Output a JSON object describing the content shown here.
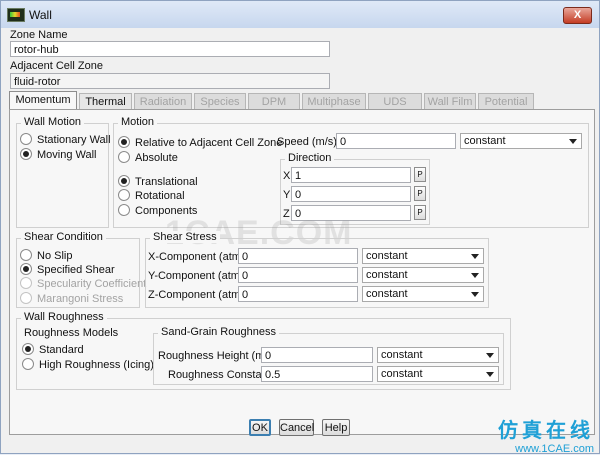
{
  "window": {
    "title": "Wall",
    "close_label": "X"
  },
  "zone_name": {
    "label": "Zone Name",
    "value": "rotor-hub"
  },
  "adjacent_cell_zone": {
    "label": "Adjacent Cell Zone",
    "value": "fluid-rotor"
  },
  "tabs": [
    {
      "label": "Momentum",
      "state": "active"
    },
    {
      "label": "Thermal",
      "state": "enabled"
    },
    {
      "label": "Radiation",
      "state": "disabled"
    },
    {
      "label": "Species",
      "state": "disabled"
    },
    {
      "label": "DPM",
      "state": "disabled"
    },
    {
      "label": "Multiphase",
      "state": "disabled"
    },
    {
      "label": "UDS",
      "state": "disabled"
    },
    {
      "label": "Wall Film",
      "state": "disabled"
    },
    {
      "label": "Potential",
      "state": "disabled"
    }
  ],
  "wall_motion": {
    "title": "Wall Motion",
    "options": [
      {
        "label": "Stationary Wall",
        "selected": false
      },
      {
        "label": "Moving Wall",
        "selected": true
      }
    ]
  },
  "motion": {
    "title": "Motion",
    "frame_options": [
      {
        "label": "Relative to Adjacent Cell Zone",
        "selected": true
      },
      {
        "label": "Absolute",
        "selected": false
      }
    ],
    "type_options": [
      {
        "label": "Translational",
        "selected": true
      },
      {
        "label": "Rotational",
        "selected": false
      },
      {
        "label": "Components",
        "selected": false
      }
    ],
    "speed_label": "Speed (m/s)",
    "speed_value": "0",
    "speed_method": "constant",
    "direction": {
      "title": "Direction",
      "x_label": "X",
      "x_value": "1",
      "y_label": "Y",
      "y_value": "0",
      "z_label": "Z",
      "z_value": "0",
      "param_label": "P"
    }
  },
  "shear_condition": {
    "title": "Shear Condition",
    "options": [
      {
        "label": "No Slip",
        "selected": false,
        "disabled": false
      },
      {
        "label": "Specified Shear",
        "selected": true,
        "disabled": false
      },
      {
        "label": "Specularity Coefficient",
        "selected": false,
        "disabled": true
      },
      {
        "label": "Marangoni Stress",
        "selected": false,
        "disabled": true
      }
    ]
  },
  "shear_stress": {
    "title": "Shear Stress",
    "rows": [
      {
        "label": "X-Component (atm)",
        "value": "0",
        "method": "constant"
      },
      {
        "label": "Y-Component (atm)",
        "value": "0",
        "method": "constant"
      },
      {
        "label": "Z-Component (atm)",
        "value": "0",
        "method": "constant"
      }
    ]
  },
  "wall_roughness": {
    "title": "Wall Roughness",
    "models": {
      "title": "Roughness Models",
      "options": [
        {
          "label": "Standard",
          "selected": true
        },
        {
          "label": "High Roughness (Icing)",
          "selected": false
        }
      ]
    },
    "sand_grain": {
      "title": "Sand-Grain Roughness",
      "height_label": "Roughness Height (m)",
      "height_value": "0",
      "height_method": "constant",
      "constant_label": "Roughness Constant",
      "constant_value": "0.5",
      "constant_method": "constant"
    }
  },
  "buttons": {
    "ok": "OK",
    "cancel": "Cancel",
    "help": "Help"
  },
  "watermark": {
    "center": "1CAE.COM",
    "corner_cn": "仿真在线",
    "corner_url": "www.1CAE.com"
  }
}
